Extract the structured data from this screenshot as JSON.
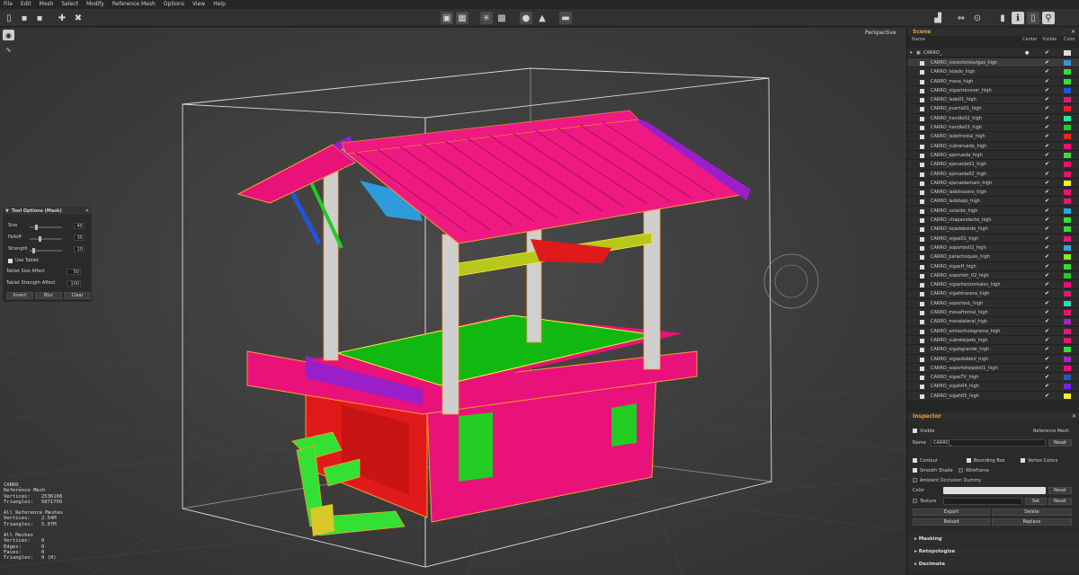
{
  "menu": [
    "File",
    "Edit",
    "Mesh",
    "Select",
    "Modify",
    "Reference Mesh",
    "Options",
    "View",
    "Help"
  ],
  "viewport": {
    "projection": "Perspective"
  },
  "tool_options": {
    "title": "Tool Options (Mask)",
    "size_label": "Size",
    "size_value": "40",
    "falloff_label": "Falloff",
    "falloff_value": "35",
    "strength_label": "Strength",
    "strength_value": "10",
    "use_tablet": "Use Tablet",
    "tablet_size_label": "Tablet Size Affect",
    "tablet_size_value": "50",
    "tablet_strength_label": "Tablet Strength Affect",
    "tablet_strength_value": "100",
    "invert": "Invert",
    "blur": "Blur",
    "clear": "Clear"
  },
  "stats": {
    "name": "CARRO_",
    "ref_label": "Reference Mesh",
    "vertices_label": "Vertices:",
    "vertices": "2536108",
    "triangles_label": "Triangles:",
    "triangles": "5071756",
    "allref_label": "All Reference Meshes",
    "allref_vertices": "2.54M",
    "allref_triangles": "5.07M",
    "all_label": "All Meshes",
    "edges_label": "Edges:",
    "faces_label": "Faces:",
    "all_vertices": "0",
    "all_edges": "0",
    "all_faces": "0",
    "all_triangles": "0 (0)"
  },
  "scene": {
    "title": "Scene",
    "col_name": "Name",
    "col_center": "Center",
    "col_visible": "Visible",
    "col_color": "Color",
    "root": "CARRO_",
    "items": [
      {
        "name": "CARRO_conectoresvigas_high",
        "color": "#2e9bdb"
      },
      {
        "name": "CARRO_tejado_high",
        "color": "#33e033"
      },
      {
        "name": "CARRO_mesa_high",
        "color": "#33e033"
      },
      {
        "name": "CARRO_vigastrensver_high",
        "color": "#2255dd"
      },
      {
        "name": "CARRO_lado01_high",
        "color": "#ee1177"
      },
      {
        "name": "CARRO_puerta01_high",
        "color": "#ee2222"
      },
      {
        "name": "CARRO_handle02_high",
        "color": "#33e0a0"
      },
      {
        "name": "CARRO_handle03_high",
        "color": "#22cc22"
      },
      {
        "name": "CARRO_ladofrontal_high",
        "color": "#ee2222"
      },
      {
        "name": "CARRO_cubrerueda_high",
        "color": "#ee1177"
      },
      {
        "name": "CARRO_ejerrueda_high",
        "color": "#33e033"
      },
      {
        "name": "CARRO_ejerueda01_high",
        "color": "#ee1177"
      },
      {
        "name": "CARRO_ejerueda02_high",
        "color": "#ee1177"
      },
      {
        "name": "CARRO_ejeruedamain_high",
        "color": "#ffee22"
      },
      {
        "name": "CARRO_ladotrasero_high",
        "color": "#ee1177"
      },
      {
        "name": "CARRO_ladobajo_high",
        "color": "#ee1177"
      },
      {
        "name": "CARRO_volante_high",
        "color": "#22aadd"
      },
      {
        "name": "CARRO_chapavolante_high",
        "color": "#33e033"
      },
      {
        "name": "CARRO_tejadoborde_high",
        "color": "#33e033"
      },
      {
        "name": "CARRO_vigas01_high",
        "color": "#ee1177"
      },
      {
        "name": "CARRO_soportes02_high",
        "color": "#22aadd"
      },
      {
        "name": "CARRO_parachoques_high",
        "color": "#88ee22"
      },
      {
        "name": "CARRO_vigasH_high",
        "color": "#33e033"
      },
      {
        "name": "CARRO_soporteh_02_high",
        "color": "#22cc22"
      },
      {
        "name": "CARRO_vigashorizontales_high",
        "color": "#ee1177"
      },
      {
        "name": "CARRO_vigahtrasera_high",
        "color": "#ee1177"
      },
      {
        "name": "CARRO_soportesL_high",
        "color": "#22ddaa"
      },
      {
        "name": "CARRO_mesafrontal_high",
        "color": "#ee1177"
      },
      {
        "name": "CARRO_mesalateral_high",
        "color": "#aa22cc"
      },
      {
        "name": "CARRO_amisorholograma_high",
        "color": "#ee1177"
      },
      {
        "name": "CARRO_cubretejado_high",
        "color": "#ee1177"
      },
      {
        "name": "CARRO_vigahgrande_high",
        "color": "#33e033"
      },
      {
        "name": "CARRO_vigasdobleV_high",
        "color": "#aa22cc"
      },
      {
        "name": "CARRO_soportetejado01_high",
        "color": "#ee1177"
      },
      {
        "name": "CARRO_vigasTV_high",
        "color": "#2255dd"
      },
      {
        "name": "CARRO_vigah04_high",
        "color": "#7722dd"
      },
      {
        "name": "CARRO_vigah05_high",
        "color": "#ffee22"
      }
    ]
  },
  "inspector": {
    "title": "Inspector",
    "visible": "Visible",
    "reference_mesh": "Reference Mesh",
    "name_label": "Name",
    "name_value": "CARRO_",
    "reset": "Reset",
    "contour": "Contour",
    "bounding_box": "Bounding Box",
    "vertex_colors": "Vertex Colors",
    "smooth_shade": "Smooth Shade",
    "wireframe": "Wireframe",
    "ao": "Ambient Occlusion Dummy",
    "color_label": "Color",
    "texture_label": "Texture",
    "set": "Set",
    "export": "Export",
    "delete": "Delete",
    "reload": "Reload",
    "replace": "Replace"
  },
  "sections": [
    "Masking",
    "Retopologize",
    "Decimate"
  ]
}
